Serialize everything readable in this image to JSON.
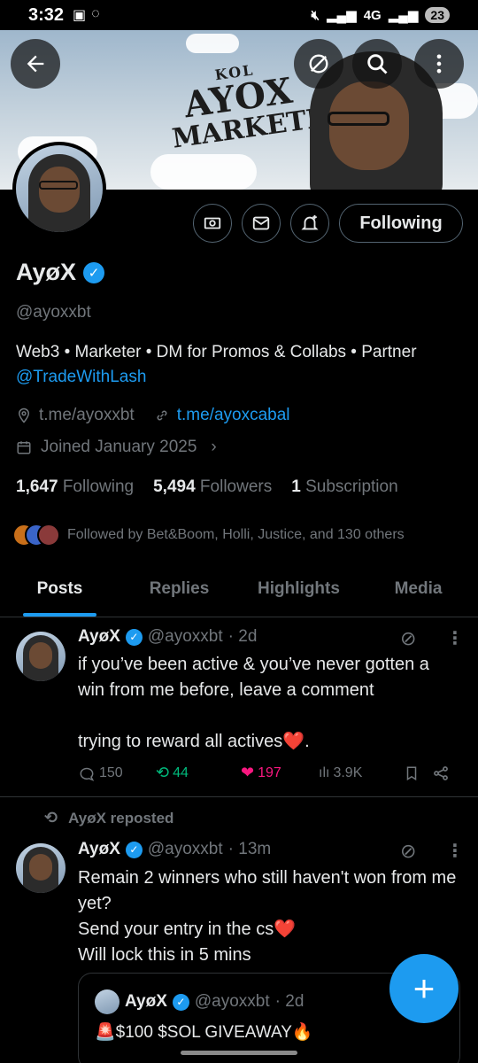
{
  "status_bar": {
    "time": "3:32",
    "network": "4G",
    "battery": "23"
  },
  "banner": {
    "line1": "KOL",
    "line2": "AYOX",
    "line3": "MARKETER"
  },
  "profile": {
    "name": "AyøX",
    "handle": "@ayoxxbt",
    "bio_text": "Web3 • Marketer • DM for Promos & Collabs • Partner",
    "bio_mention": "@TradeWithLash",
    "location_link": "t.me/ayoxxbt",
    "website": "t.me/ayoxcabal",
    "joined": "Joined January 2025",
    "following_count": "1,647",
    "following_label": "Following",
    "followers_count": "5,494",
    "followers_label": "Followers",
    "subscription_count": "1",
    "subscription_label": "Subscription",
    "followed_by": "Followed by Bet&Boom, Holli, Justice, and 130 others"
  },
  "actions": {
    "follow_label": "Following"
  },
  "tabs": [
    "Posts",
    "Replies",
    "Highlights",
    "Media"
  ],
  "posts": [
    {
      "name": "AyøX",
      "handle": "@ayoxxbt",
      "time": "· 2d",
      "text": "if you’ve been active & you’ve never gotten a win from me before, leave a comment\n\ntrying to reward all actives❤️.",
      "replies": "150",
      "reposts": "44",
      "likes": "197",
      "views": "3.9K"
    },
    {
      "repost_label": "AyøX reposted",
      "name": "AyøX",
      "handle": "@ayoxxbt",
      "time": "· 13m",
      "text": "Remain 2 winners who still haven't won from me yet?\nSend your entry in the cs❤️\nWill lock this in 5 mins",
      "quote": {
        "name": "AyøX",
        "handle": "@ayoxxbt",
        "time": "· 2d",
        "text": "🚨$100 $SOL GIVEAWAY🔥"
      }
    }
  ],
  "colors": {
    "accent": "#1d9bf0",
    "like": "#f91880",
    "repost": "#00ba7c",
    "background": "#000000"
  }
}
